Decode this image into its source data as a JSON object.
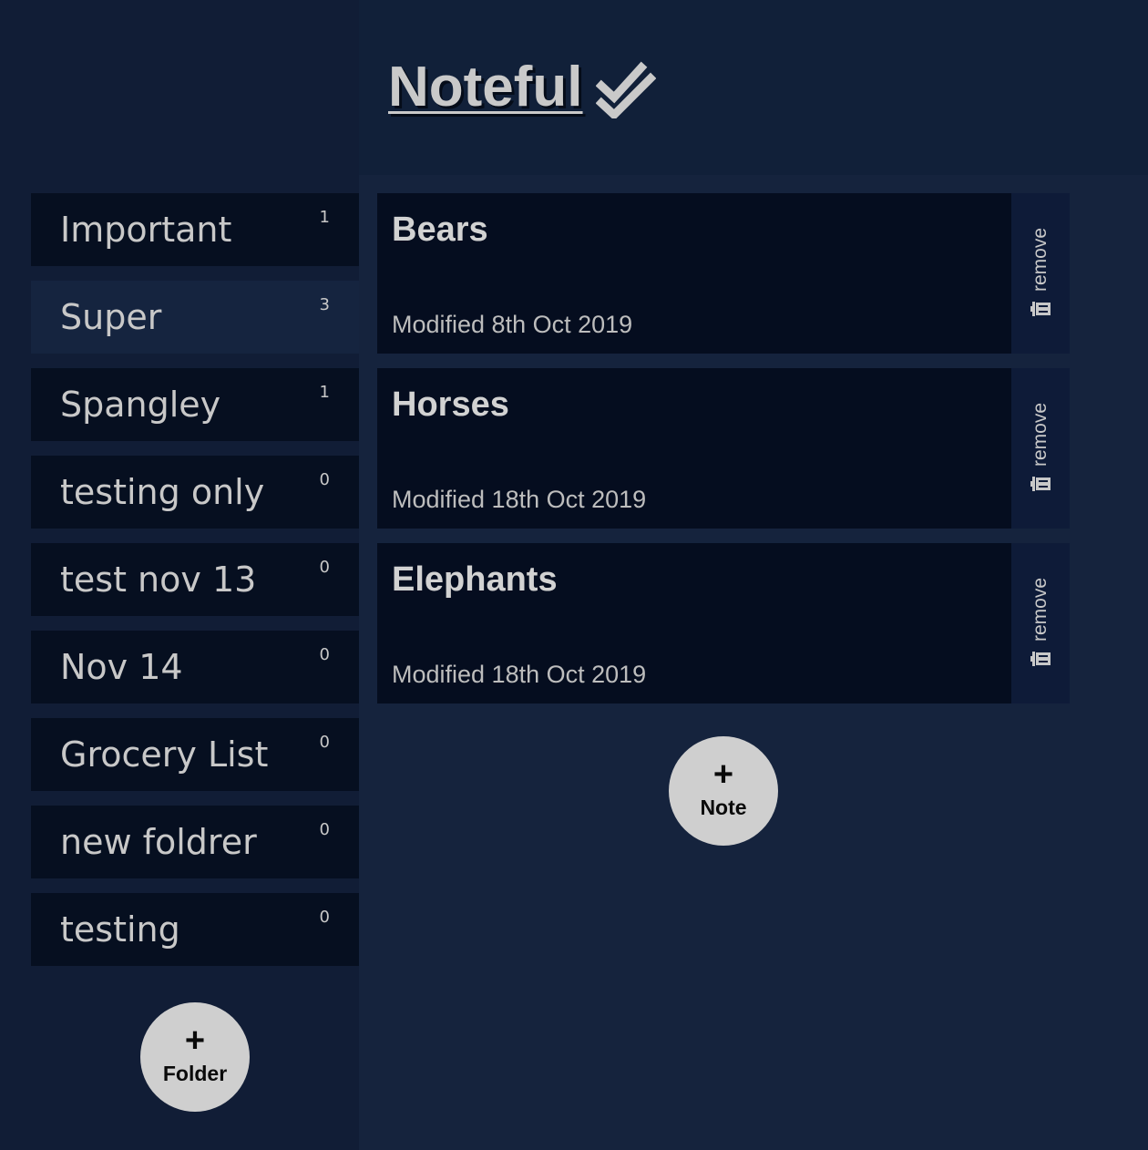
{
  "app": {
    "title": "Noteful"
  },
  "folders": [
    {
      "name": "Important",
      "count": "1",
      "active": false
    },
    {
      "name": "Super",
      "count": "3",
      "active": true
    },
    {
      "name": "Spangley",
      "count": "1",
      "active": false
    },
    {
      "name": "testing only",
      "count": "0",
      "active": false
    },
    {
      "name": "test nov 13",
      "count": "0",
      "active": false
    },
    {
      "name": "Nov 14",
      "count": "0",
      "active": false
    },
    {
      "name": "Grocery List",
      "count": "0",
      "active": false
    },
    {
      "name": "new foldrer",
      "count": "0",
      "active": false
    },
    {
      "name": "testing",
      "count": "0",
      "active": false
    }
  ],
  "add_folder": {
    "plus": "+",
    "label": "Folder"
  },
  "notes": [
    {
      "title": "Bears",
      "modified": "Modified 8th Oct 2019",
      "remove_label": "remove"
    },
    {
      "title": "Horses",
      "modified": "Modified 18th Oct 2019",
      "remove_label": "remove"
    },
    {
      "title": "Elephants",
      "modified": "Modified 18th Oct 2019",
      "remove_label": "remove"
    }
  ],
  "add_note": {
    "plus": "+",
    "label": "Note"
  },
  "icons": {
    "title_icon": "double-check-icon",
    "remove_icon": "trash-icon"
  },
  "colors": {
    "sidebar_bg": "#111d36",
    "main_bg": "#15233d",
    "item_bg": "#060f20",
    "active_item_bg": "#15243f",
    "text": "#c8c8c8",
    "button_bg": "#cfcfcf"
  }
}
